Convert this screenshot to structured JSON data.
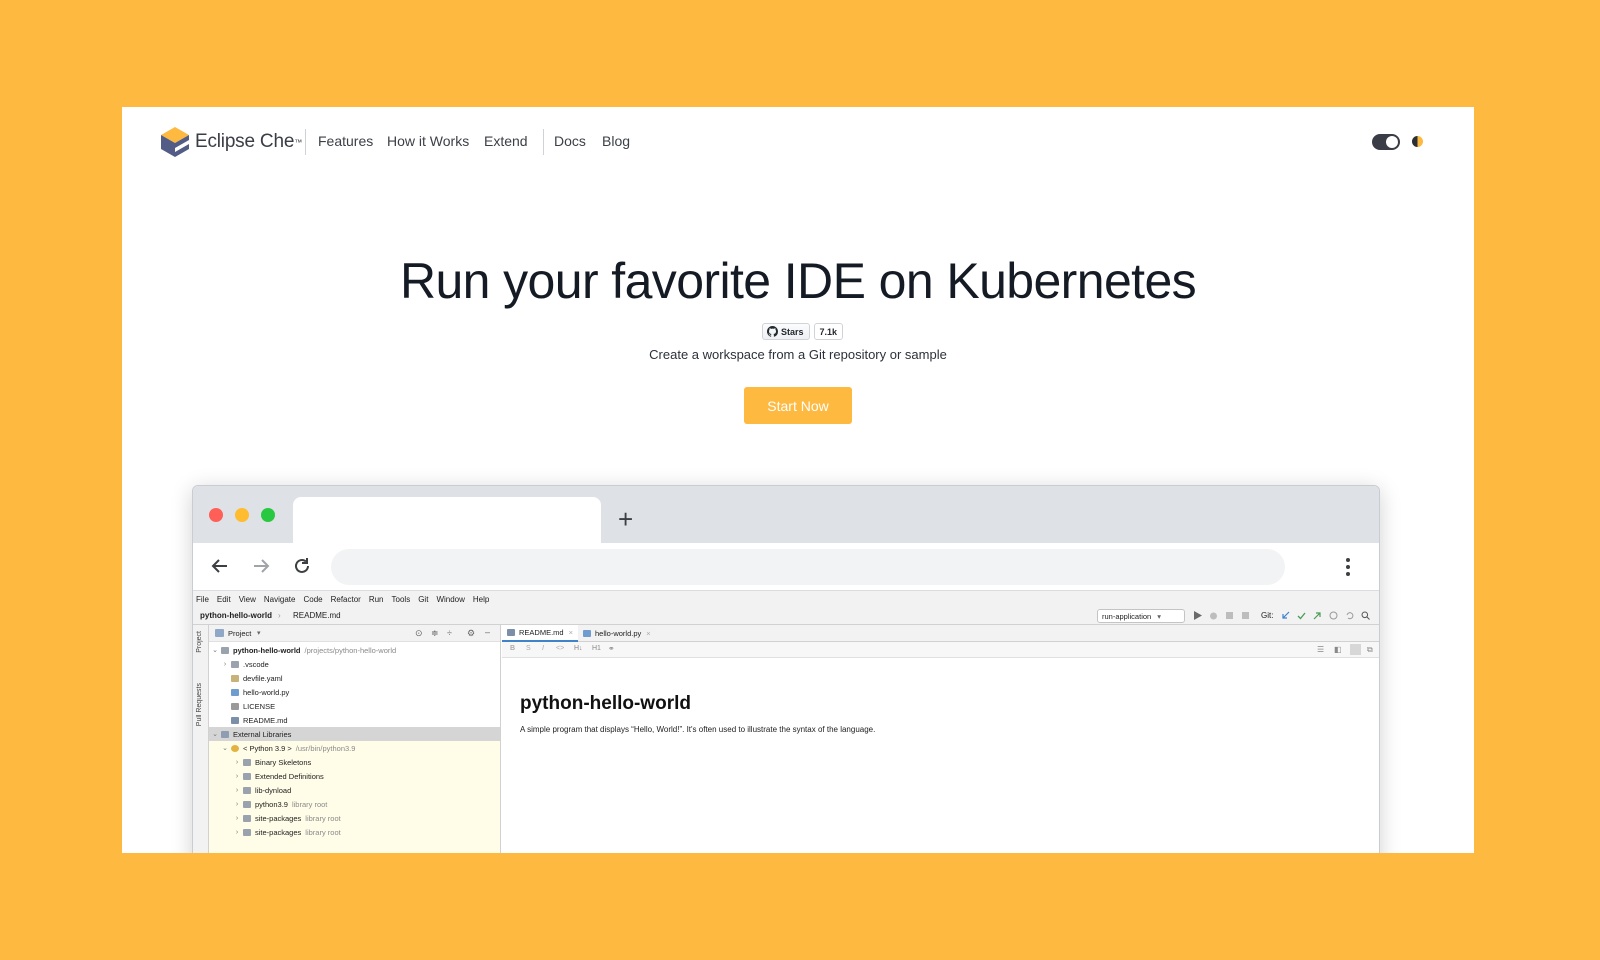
{
  "nav": {
    "brand": "Eclipse Che",
    "brand_tm": "™",
    "links": [
      "Features",
      "How it Works",
      "Extend",
      "Docs",
      "Blog"
    ]
  },
  "hero": {
    "title": "Run your favorite IDE on Kubernetes",
    "stars_label": "Stars",
    "stars_count": "7.1k",
    "subtitle": "Create a workspace from a Git repository or sample",
    "cta_label": "Start Now"
  },
  "browser": {
    "new_tab_label": "+"
  },
  "ide": {
    "menu": [
      "File",
      "Edit",
      "View",
      "Navigate",
      "Code",
      "Refactor",
      "Run",
      "Tools",
      "Git",
      "Window",
      "Help"
    ],
    "breadcrumb": [
      "python-hello-world",
      "README.md"
    ],
    "run_config": "run-application",
    "git_label": "Git:",
    "side_tabs": [
      "Project",
      "Pull Requests"
    ],
    "project_title": "Project",
    "tree": [
      {
        "label": "python-hello-world",
        "hint": "/projects/python-hello-world"
      },
      {
        "label": ".vscode",
        "hint": ""
      },
      {
        "label": "devfile.yaml",
        "hint": ""
      },
      {
        "label": "hello-world.py",
        "hint": ""
      },
      {
        "label": "LICENSE",
        "hint": ""
      },
      {
        "label": "README.md",
        "hint": ""
      },
      {
        "label": "External Libraries",
        "hint": ""
      },
      {
        "label": "< Python 3.9 >",
        "hint": "/usr/bin/python3.9"
      },
      {
        "label": "Binary Skeletons",
        "hint": ""
      },
      {
        "label": "Extended Definitions",
        "hint": ""
      },
      {
        "label": "lib-dynload",
        "hint": ""
      },
      {
        "label": "python3.9",
        "hint": "library root"
      },
      {
        "label": "site-packages",
        "hint": "library root"
      },
      {
        "label": "site-packages",
        "hint": "library root"
      }
    ],
    "editor_tabs": [
      "README.md",
      "hello-world.py"
    ],
    "doc_heading": "python-hello-world",
    "doc_text": "A simple program that displays “Hello, World!”. It's often used to illustrate the syntax of the language."
  },
  "colors": {
    "background": "#FEB941",
    "accent": "#FDB940",
    "text": "#151b24"
  }
}
